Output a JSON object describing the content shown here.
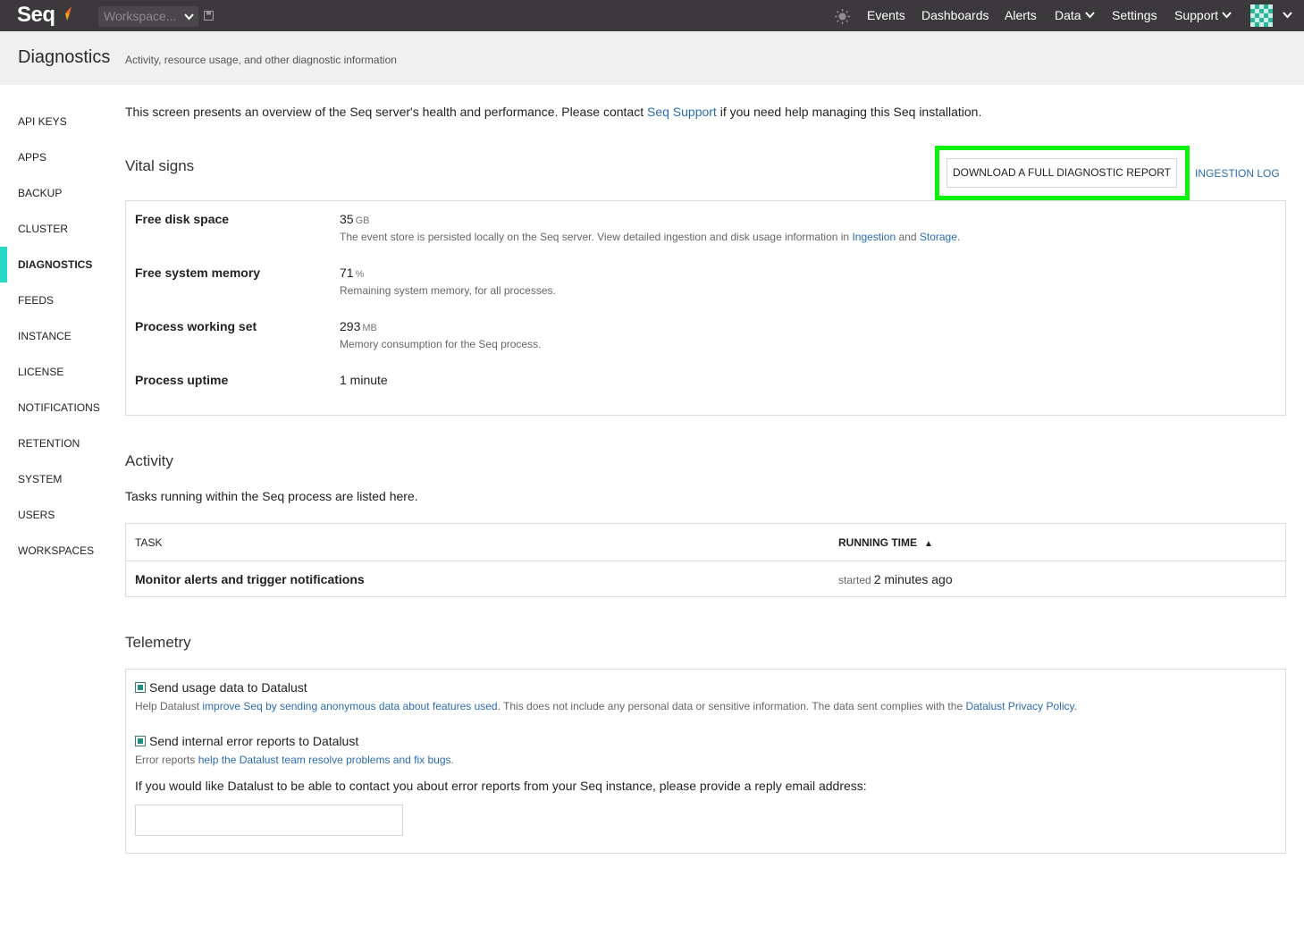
{
  "topbar": {
    "logo": "Seq",
    "workspace_placeholder": "Workspace...",
    "nav": {
      "events": "Events",
      "dashboards": "Dashboards",
      "alerts": "Alerts",
      "data": "Data",
      "settings": "Settings",
      "support": "Support"
    }
  },
  "header": {
    "title": "Diagnostics",
    "subtitle": "Activity, resource usage, and other diagnostic information"
  },
  "sidebar": {
    "items": [
      {
        "label": "API Keys"
      },
      {
        "label": "Apps"
      },
      {
        "label": "Backup"
      },
      {
        "label": "Cluster"
      },
      {
        "label": "Diagnostics"
      },
      {
        "label": "Feeds"
      },
      {
        "label": "Instance"
      },
      {
        "label": "License"
      },
      {
        "label": "Notifications"
      },
      {
        "label": "Retention"
      },
      {
        "label": "System"
      },
      {
        "label": "Users"
      },
      {
        "label": "Workspaces"
      }
    ],
    "active_index": 4
  },
  "intro": {
    "before": "This screen presents an overview of the Seq server's health and performance. Please contact ",
    "link": "Seq Support",
    "after": " if you need help managing this Seq installation."
  },
  "vital_signs": {
    "title": "Vital signs",
    "download_label": "Download a full diagnostic report",
    "ingestion_log_label": "Ingestion log",
    "rows": [
      {
        "label": "Free disk space",
        "value": "35",
        "unit": "GB",
        "desc_before": "The event store is persisted locally on the Seq server. View detailed ingestion and disk usage information in ",
        "desc_link1": "Ingestion",
        "desc_mid": " and ",
        "desc_link2": "Storage",
        "desc_after": "."
      },
      {
        "label": "Free system memory",
        "value": "71",
        "unit": "%",
        "desc": "Remaining system memory, for all processes."
      },
      {
        "label": "Process working set",
        "value": "293",
        "unit": "MB",
        "desc": "Memory consumption for the Seq process."
      },
      {
        "label": "Process uptime",
        "value": "1 minute"
      }
    ]
  },
  "activity": {
    "title": "Activity",
    "intro": "Tasks running within the Seq process are listed here.",
    "columns": {
      "task": "Task",
      "running_time": "Running time",
      "sort_indicator": "▲"
    },
    "rows": [
      {
        "task": "Monitor alerts and trigger notifications",
        "started_prefix": "started",
        "running_time": "2 minutes ago"
      }
    ]
  },
  "telemetry": {
    "title": "Telemetry",
    "usage": {
      "label": "Send usage data to Datalust",
      "checked": true,
      "desc_before": "Help Datalust ",
      "desc_link": "improve Seq by sending anonymous data about features used",
      "desc_mid": ". This does not include any personal data or sensitive information. The data sent complies with the ",
      "desc_link2": "Datalust Privacy Policy",
      "desc_after": "."
    },
    "errors": {
      "label": "Send internal error reports to Datalust",
      "checked": true,
      "desc_before": "Error reports ",
      "desc_link": "help the Datalust team resolve problems and fix bugs",
      "desc_after": "."
    },
    "email_prompt": "If you would like Datalust to be able to contact you about error reports from your Seq instance, please provide a reply email address:",
    "email_value": ""
  }
}
